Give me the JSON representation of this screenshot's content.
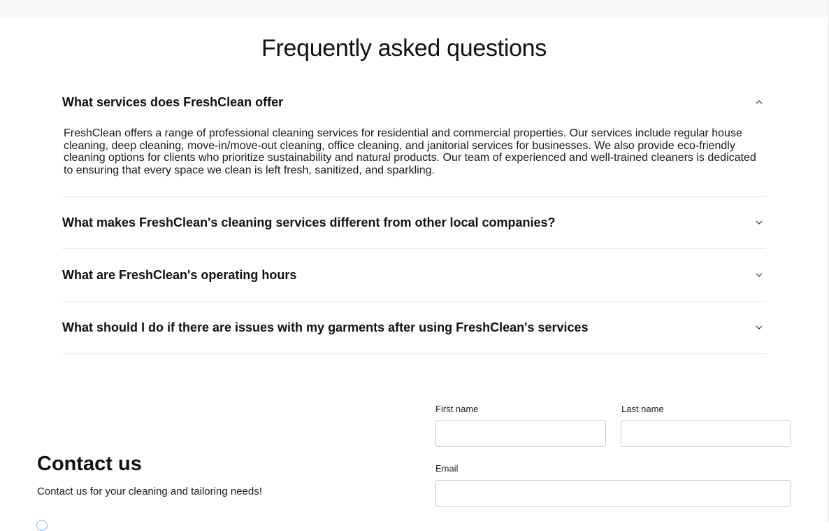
{
  "faq": {
    "title": "Frequently asked questions",
    "items": [
      {
        "question": "What services does FreshClean offer",
        "answer": "FreshClean offers a range of professional cleaning services for residential and commercial properties. Our services include regular house cleaning, deep cleaning, move-in/move-out cleaning, office cleaning, and janitorial services for businesses. We also provide eco-friendly cleaning options for clients who prioritize sustainability and natural products. Our team of experienced and well-trained cleaners is dedicated to ensuring that every space we clean is left fresh, sanitized, and sparkling.",
        "expanded": true,
        "icon": "chevron-up-icon"
      },
      {
        "question": "What makes FreshClean's cleaning services different from other local companies?",
        "expanded": false,
        "icon": "chevron-down-icon"
      },
      {
        "question": "What are FreshClean's operating hours",
        "expanded": false,
        "icon": "chevron-down-icon"
      },
      {
        "question": "What should I do if there are issues with my garments after using FreshClean's services",
        "expanded": false,
        "icon": "chevron-down-icon"
      }
    ]
  },
  "contact": {
    "title": "Contact us",
    "subtitle": "Contact us for your cleaning and tailoring needs!",
    "form": {
      "first_name_label": "First name",
      "first_name_value": "",
      "last_name_label": "Last name",
      "last_name_value": "",
      "email_label": "Email",
      "email_value": ""
    }
  },
  "colors": {
    "divider": "#e5e5e5",
    "input_border": "#c9c9c9",
    "accent": "#7fb6e8"
  }
}
